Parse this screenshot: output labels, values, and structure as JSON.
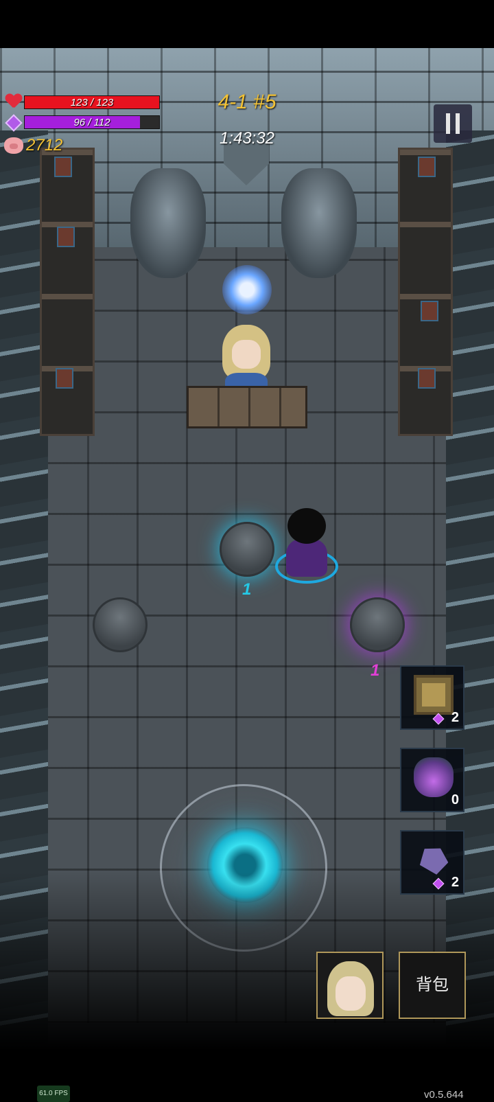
{
  "hud": {
    "hp_text": "123 / 123",
    "hp_fraction": 1.0,
    "mp_text": "96 / 112",
    "mp_fraction": 0.857,
    "gold": "2712",
    "level": "4-1 #5",
    "timer": "1:43:32"
  },
  "floating_numbers": [
    "1",
    "1"
  ],
  "items": [
    {
      "icon": "rune-cube-icon",
      "count": "2",
      "has_gem_cost": true
    },
    {
      "icon": "potion-icon",
      "count": "0",
      "has_gem_cost": false
    },
    {
      "icon": "d20-dice-icon",
      "count": "2",
      "has_gem_cost": true
    }
  ],
  "buttons": {
    "bag_label": "背包"
  },
  "footer": {
    "fps": "61.0 FPS",
    "version": "v0.5.644"
  },
  "colors": {
    "hp": "#e8121f",
    "mp": "#a51fdc",
    "gold": "#f3c235",
    "cyan_glow": "#28c0e6",
    "purple_glow": "#a73fd6"
  }
}
